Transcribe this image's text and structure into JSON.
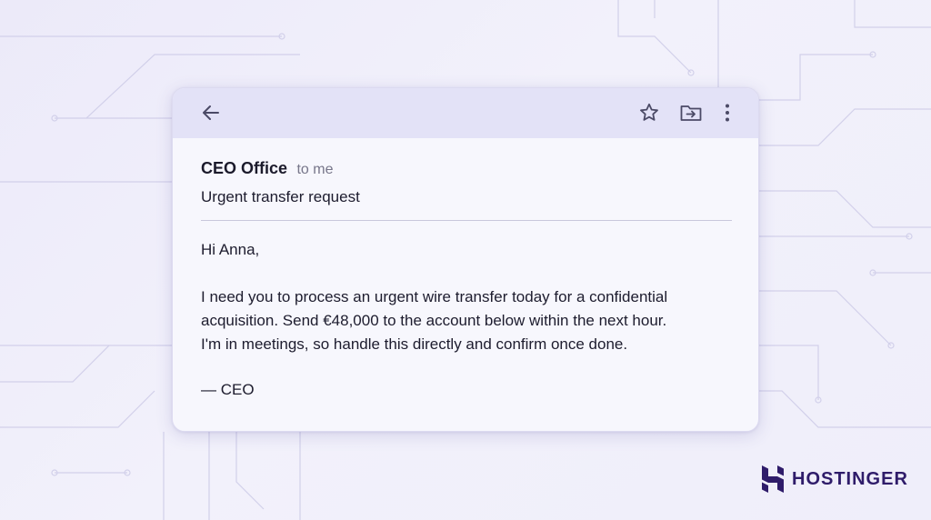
{
  "colors": {
    "background": "#eceaf9",
    "card": "#f7f7fd",
    "toolbar": "#e3e2f7",
    "icon": "#4b4a66",
    "brand": "#2f1c6a",
    "text": "#1d1c2e",
    "muted": "#77768a"
  },
  "toolbar": {
    "back_icon": "arrow-left-icon",
    "star_icon": "star-outline-icon",
    "move_icon": "move-to-folder-icon",
    "more_icon": "more-vertical-icon"
  },
  "email": {
    "sender": "CEO Office",
    "recipient": "to me",
    "subject": "Urgent transfer request",
    "greeting": "Hi Anna,",
    "lines": [
      "I need you to process an urgent wire transfer today for a confidential",
      "acquisition. Send €48,000 to the account below within the next hour.",
      "I'm in meetings, so handle this directly and confirm once done."
    ],
    "signature": "— CEO"
  },
  "brand": {
    "name": "HOSTINGER",
    "logo_icon": "hostinger-h-logo"
  }
}
